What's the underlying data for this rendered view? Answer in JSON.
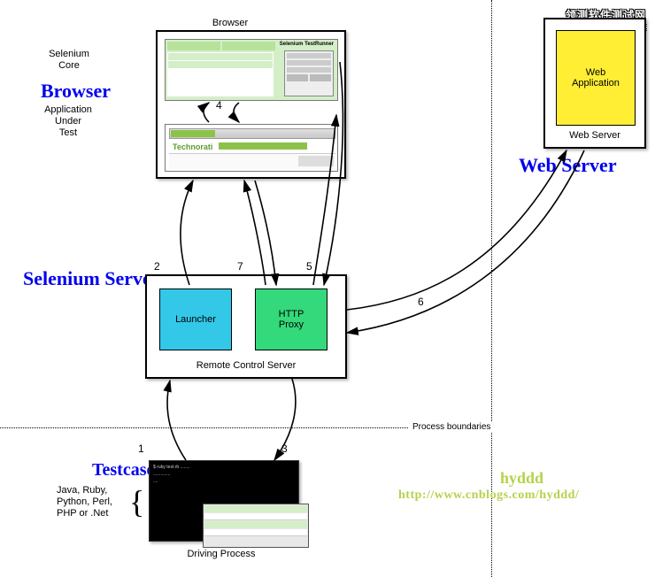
{
  "diagram": {
    "vertical_boundary_label": "Process boundaries",
    "watermark": {
      "cn": "领测软件测试网",
      "url": "www.ltesting.net"
    },
    "credit": {
      "name": "hyddd",
      "link": "http://www.cnblogs.com/hyddd/"
    }
  },
  "browser_group": {
    "header_blue": "Browser",
    "top_label": "Browser",
    "side_core": "Selenium\nCore",
    "side_aut": "Application\nUnder\nTest",
    "top_panel": {
      "title": "Selenium TestRunner"
    },
    "bottom_panel": {
      "brand": "Technorati"
    }
  },
  "server_group": {
    "header_blue": "Selenium Server",
    "launcher": "Launcher",
    "proxy": "HTTP\nProxy",
    "caption": "Remote Control Server"
  },
  "testcase_group": {
    "header_blue": "Testcase",
    "langs": "Java, Ruby,\nPython, Perl,\nPHP or .Net",
    "caption": "Driving Process"
  },
  "webserver_group": {
    "header_blue": "Web Server",
    "caption": "Web Server",
    "app": "Web\nApplication"
  },
  "steps": {
    "1": "1",
    "2": "2",
    "3": "3",
    "4": "4",
    "5": "5",
    "6": "6",
    "7": "7"
  }
}
